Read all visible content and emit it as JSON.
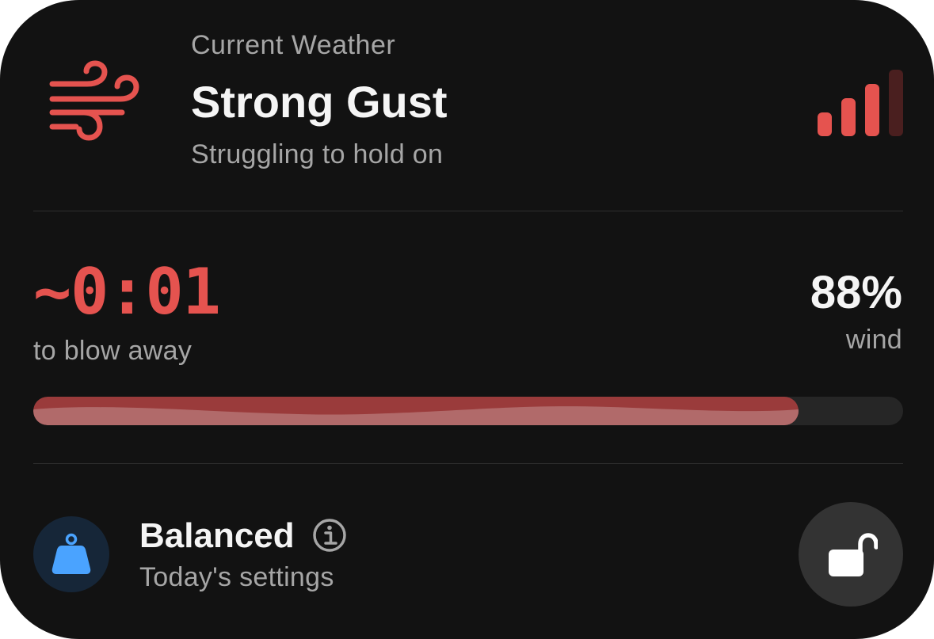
{
  "header": {
    "label": "Current Weather",
    "title": "Strong Gust",
    "description": "Struggling to hold on",
    "icon": "wind-icon",
    "signal_icon": "signal-strength-icon",
    "signal_level": 3,
    "signal_max": 4
  },
  "status": {
    "countdown": "~0:01",
    "countdown_caption": "to blow away",
    "percent": "88%",
    "percent_caption": "wind",
    "progress": 0.88
  },
  "mode": {
    "title": "Balanced",
    "description": "Today's settings",
    "icon": "weight-icon",
    "info_icon": "info-icon",
    "lock_icon": "unlocked-padlock-icon"
  },
  "colors": {
    "accent": "#e5534f",
    "accent_dim": "#4a1f1f",
    "progress_fill": "#9a3b3b",
    "mode_icon": "#4aa3ff",
    "mode_badge_bg": "#162638",
    "background": "#121212"
  }
}
